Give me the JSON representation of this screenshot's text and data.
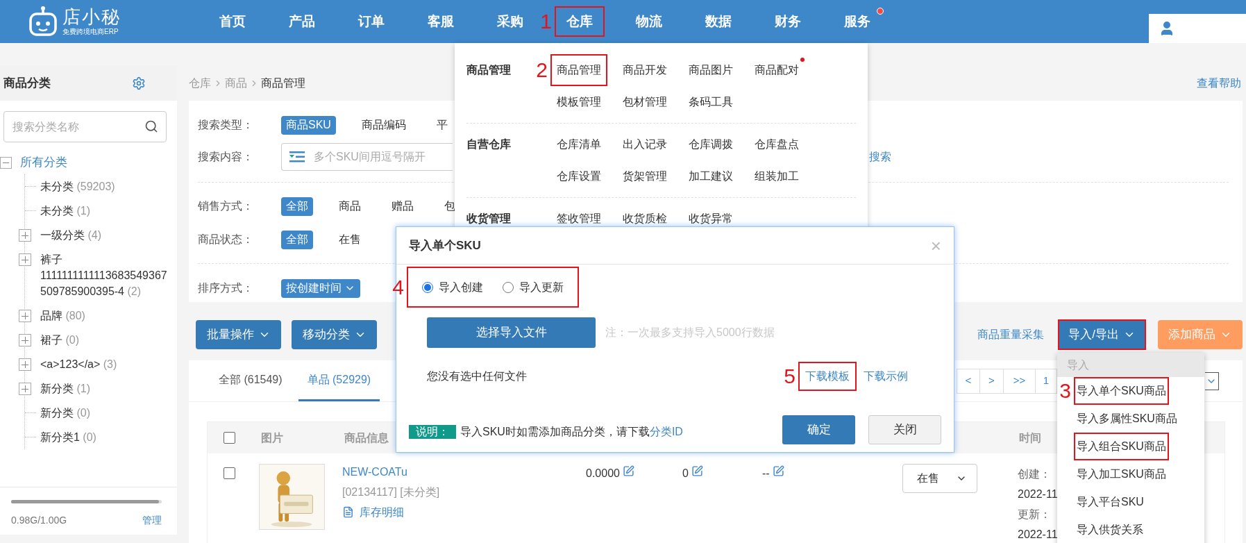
{
  "header": {
    "logo": {
      "name": "店小秘",
      "tagline": "免费跨境电商ERP"
    },
    "nav": [
      {
        "label": "首页",
        "highlighted": false,
        "dot": false
      },
      {
        "label": "产品",
        "highlighted": false,
        "dot": false
      },
      {
        "label": "订单",
        "highlighted": false,
        "dot": false
      },
      {
        "label": "客服",
        "highlighted": false,
        "dot": false
      },
      {
        "label": "采购",
        "highlighted": false,
        "dot": false
      },
      {
        "label": "仓库",
        "highlighted": true,
        "step": "1",
        "dot": false
      },
      {
        "label": "物流",
        "highlighted": false,
        "dot": false
      },
      {
        "label": "数据",
        "highlighted": false,
        "dot": false
      },
      {
        "label": "财务",
        "highlighted": false,
        "dot": false
      },
      {
        "label": "服务",
        "highlighted": false,
        "dot": true
      }
    ]
  },
  "sidebar": {
    "title": "商品分类",
    "search_placeholder": "搜索分类名称",
    "tree": {
      "label": "所有分类",
      "expanded": true,
      "children": [
        {
          "label": "未分类",
          "count": "(59203)",
          "has_children": false
        },
        {
          "label": "未分类",
          "count": "(1)",
          "has_children": false
        },
        {
          "label": "一级分类",
          "count": "(4)",
          "has_children": true
        },
        {
          "label": "裤子 1111111111113683549367509785900395-4",
          "count": "(2)",
          "has_children": true
        },
        {
          "label": "品牌",
          "count": "(80)",
          "has_children": true
        },
        {
          "label": "裙子",
          "count": "(0)",
          "has_children": true
        },
        {
          "label": "<a>123</a>",
          "count": "(3)",
          "has_children": true
        },
        {
          "label": "新分类",
          "count": "(1)",
          "has_children": true
        },
        {
          "label": "新分类",
          "count": "(0)",
          "has_children": false
        },
        {
          "label": "新分类1",
          "count": "(0)",
          "has_children": false
        }
      ]
    },
    "storage": {
      "level": 0.98,
      "text": "0.98G/1.00G",
      "manage": "管理"
    }
  },
  "breadcrumb": [
    "仓库",
    "商品",
    "商品管理"
  ],
  "help": "查看帮助",
  "filters": [
    {
      "label": "搜索类型：",
      "kind": "chips",
      "options": [
        {
          "label": "商品SKU",
          "selected": true
        },
        {
          "label": "商品编码",
          "selected": false
        },
        {
          "label": "平",
          "selected": false
        }
      ]
    },
    {
      "label": "搜索内容：",
      "kind": "input",
      "placeholder": "多个SKU间用逗号隔开",
      "link": "搜索"
    },
    {
      "label": "销售方式：",
      "kind": "chips",
      "options": [
        {
          "label": "全部",
          "selected": true
        },
        {
          "label": "商品",
          "selected": false
        },
        {
          "label": "赠品",
          "selected": false
        },
        {
          "label": "包",
          "selected": false
        }
      ]
    },
    {
      "label": "商品状态：",
      "kind": "chips",
      "options": [
        {
          "label": "全部",
          "selected": true
        },
        {
          "label": "在售",
          "selected": false
        }
      ]
    },
    {
      "label": "排序方式：",
      "kind": "sort",
      "options": [
        {
          "label": "按创建时间",
          "selected": true
        }
      ]
    }
  ],
  "toolbar": {
    "buttons": [
      "批量操作",
      "移动分类"
    ],
    "link": "商品重量采集",
    "import_export": {
      "label": "导入/导出",
      "highlighted": true
    },
    "add": "添加商品"
  },
  "tabs": [
    {
      "label": "全部 (61549)",
      "selected": false
    },
    {
      "label": "单品 (52929)",
      "selected": true
    }
  ],
  "pagination": [
    "<",
    ">",
    ">>",
    "1"
  ],
  "table": {
    "header_checked": false,
    "columns": [
      "图片",
      "商品信息",
      "时间"
    ],
    "rows": [
      {
        "checked": false,
        "name": "NEW-COATu",
        "meta": "[02134117] [未分类]",
        "stock_link": "库存明细",
        "price": "0.0000",
        "quantity": "0",
        "column_6": "--",
        "status": "在售",
        "created_label": "创建：",
        "created": "2022-11",
        "updated_label": "更新：",
        "updated": "2022-11"
      }
    ]
  },
  "menu": {
    "groups": [
      {
        "title": "商品管理",
        "items": [
          {
            "label": "商品管理",
            "highlighted": true,
            "step": "2",
            "dot": false
          },
          {
            "label": "商品开发",
            "highlighted": false,
            "dot": false
          },
          {
            "label": "商品图片",
            "highlighted": false,
            "dot": false
          },
          {
            "label": "商品配对",
            "highlighted": false,
            "dot": true
          },
          {
            "label": "模板管理",
            "highlighted": false,
            "dot": false
          },
          {
            "label": "包材管理",
            "highlighted": false,
            "dot": false
          },
          {
            "label": "条码工具",
            "highlighted": false,
            "dot": false
          }
        ]
      },
      {
        "title": "自营仓库",
        "items": [
          {
            "label": "仓库清单",
            "highlighted": false,
            "dot": false
          },
          {
            "label": "出入记录",
            "highlighted": false,
            "dot": false
          },
          {
            "label": "仓库调拨",
            "highlighted": false,
            "dot": false
          },
          {
            "label": "仓库盘点",
            "highlighted": false,
            "dot": false
          },
          {
            "label": "仓库设置",
            "highlighted": false,
            "dot": false
          },
          {
            "label": "货架管理",
            "highlighted": false,
            "dot": false
          },
          {
            "label": "加工建议",
            "highlighted": false,
            "dot": false
          },
          {
            "label": "组装加工",
            "highlighted": false,
            "dot": false
          }
        ]
      },
      {
        "title": "收货管理",
        "items": [
          {
            "label": "签收管理",
            "highlighted": false,
            "dot": false
          },
          {
            "label": "收货质检",
            "highlighted": false,
            "dot": false
          },
          {
            "label": "收货异常",
            "highlighted": false,
            "dot": false
          }
        ]
      }
    ]
  },
  "dialog": {
    "title": "导入单个SKU",
    "close": "×",
    "mode_group": {
      "highlighted": true,
      "step": "4",
      "options": [
        {
          "label": "导入创建",
          "selected": true
        },
        {
          "label": "导入更新",
          "selected": false
        }
      ]
    },
    "choose_button": "选择导入文件",
    "note": "注：一次最多支持导入5000行数据",
    "file_status": "您没有选中任何文件",
    "links": [
      {
        "label": "下载模板",
        "highlighted": true,
        "step": "5"
      },
      {
        "label": "下载示例",
        "highlighted": false
      }
    ],
    "info_badge": "说明：",
    "info_text": "导入SKU时如需添加商品分类，请下载",
    "info_link": "分类ID",
    "confirm": "确定",
    "cancel": "关闭"
  },
  "import_menu": {
    "header": "导入",
    "items": [
      {
        "label": "导入单个SKU商品",
        "highlighted": true,
        "step": "3"
      },
      {
        "label": "导入多属性SKU商品",
        "highlighted": false
      },
      {
        "label": "导入组合SKU商品",
        "highlighted": true
      },
      {
        "label": "导入加工SKU商品",
        "highlighted": false
      },
      {
        "label": "导入平台SKU",
        "highlighted": false
      },
      {
        "label": "导入供货关系",
        "highlighted": false
      }
    ]
  }
}
